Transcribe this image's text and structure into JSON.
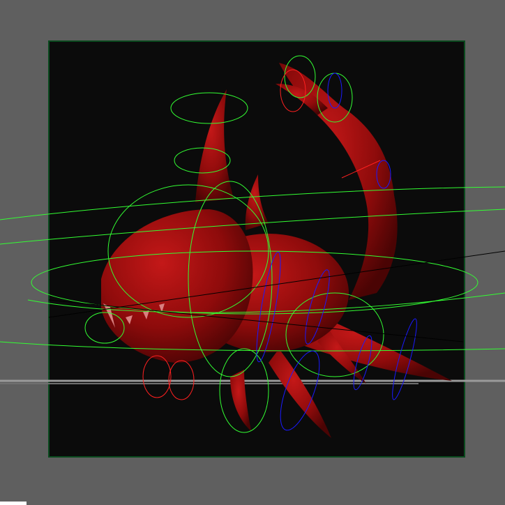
{
  "colors": {
    "background": "#5f5f5f",
    "viewport": "#0b0b0b",
    "viewport_border": "#0a4a1e",
    "mesh": "#8e0b0b",
    "mesh_highlight": "#c42020",
    "control_green": "#33ff33",
    "control_blue": "#1a1aff",
    "control_red": "#ff2020",
    "grid": "#9a9a9a"
  }
}
